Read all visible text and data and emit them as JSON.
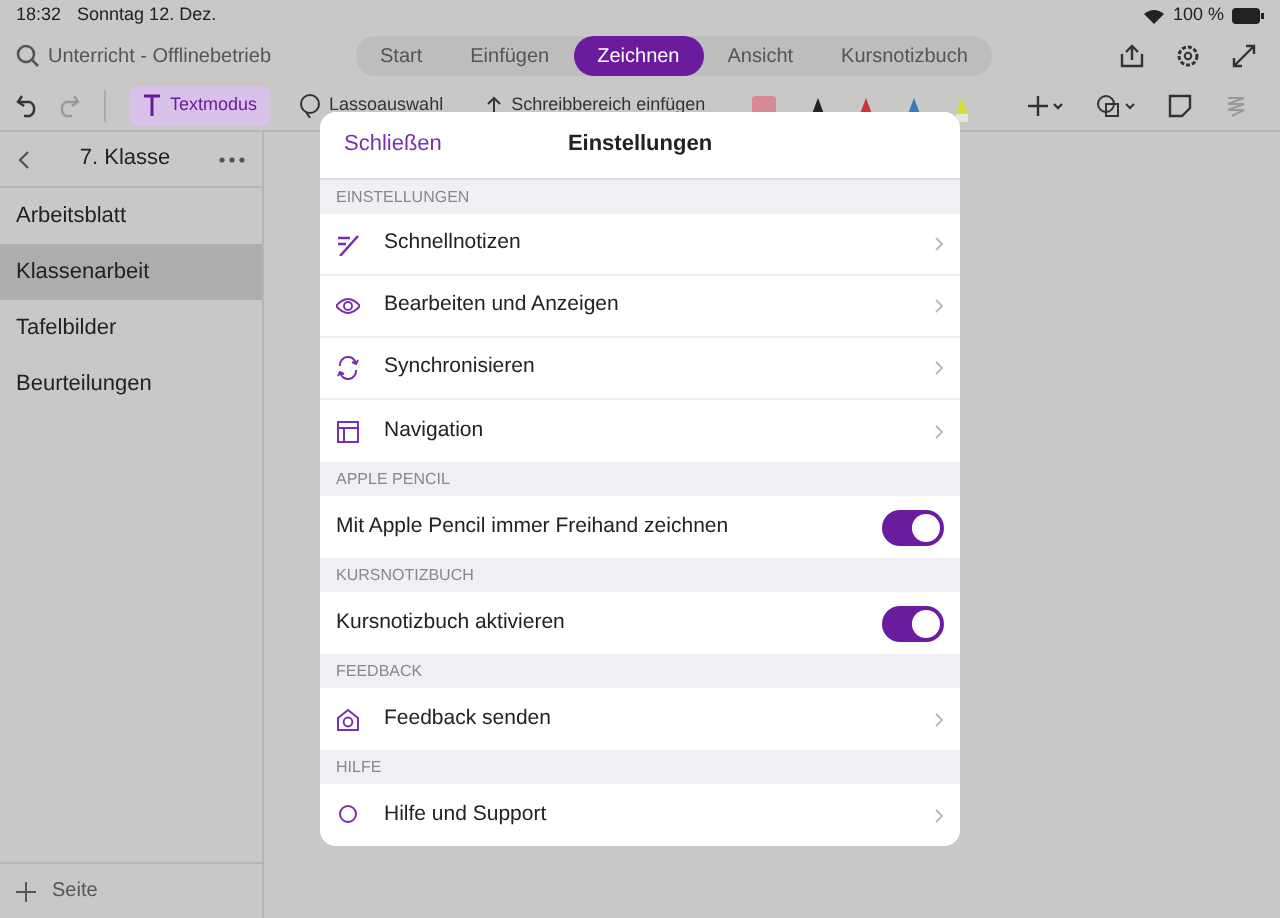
{
  "status_bar": {
    "time": "18:32",
    "date": "Sonntag 12. Dez.",
    "battery": "100 %"
  },
  "search": {
    "placeholder": "Unterricht - Offlinebetrieb"
  },
  "tabs": [
    {
      "label": "Start",
      "selected": false
    },
    {
      "label": "Einfügen",
      "selected": false
    },
    {
      "label": "Zeichnen",
      "selected": true
    },
    {
      "label": "Ansicht",
      "selected": false
    },
    {
      "label": "Kursnotizbuch",
      "selected": false
    }
  ],
  "toolbar": [
    {
      "label": "Textmodus",
      "selected": true
    },
    {
      "label": "Lassoauswahl",
      "selected": false
    },
    {
      "label": "Schreibbereich einfügen",
      "selected": false
    }
  ],
  "sidebar": {
    "title": "7. Klasse",
    "items": [
      {
        "label": "Arbeitsblatt",
        "selected": false
      },
      {
        "label": "Klassenarbeit",
        "selected": true
      },
      {
        "label": "Tafelbilder",
        "selected": false
      },
      {
        "label": "Beurteilungen",
        "selected": false
      }
    ],
    "add_page": "Seite"
  },
  "dialog": {
    "close": "Schließen",
    "title": "Einstellungen",
    "sections": [
      {
        "header": "EINSTELLUNGEN",
        "items": [
          {
            "kind": "link",
            "label": "Schnellnotizen"
          },
          {
            "kind": "link",
            "label": "Bearbeiten und Anzeigen"
          },
          {
            "kind": "link",
            "label": "Synchronisieren"
          },
          {
            "kind": "link",
            "label": "Navigation"
          }
        ]
      },
      {
        "header": "APPLE PENCIL",
        "items": [
          {
            "kind": "toggle",
            "label": "Mit Apple Pencil immer Freihand zeichnen",
            "on": true
          }
        ]
      },
      {
        "header": "KURSNOTIZBUCH",
        "items": [
          {
            "kind": "toggle",
            "label": "Kursnotizbuch aktivieren",
            "on": true
          }
        ]
      },
      {
        "header": "FEEDBACK",
        "items": [
          {
            "kind": "link",
            "label": "Feedback senden"
          }
        ]
      },
      {
        "header": "HILFE",
        "items": [
          {
            "kind": "link",
            "label": "Hilfe und Support"
          }
        ]
      }
    ]
  }
}
